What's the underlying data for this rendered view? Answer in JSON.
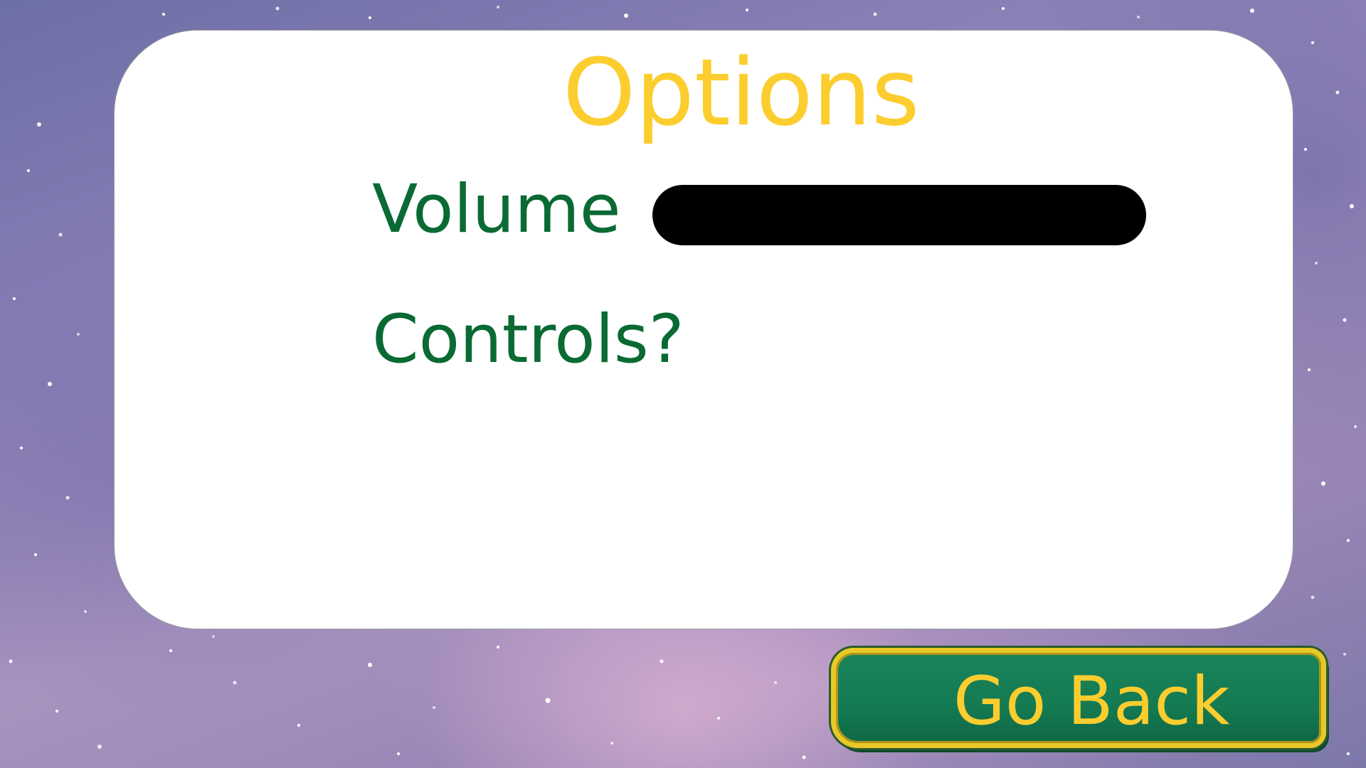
{
  "options_menu": {
    "title": "Options",
    "volume_label": "Volume",
    "volume_level": 1.0,
    "controls_label": "Controls?",
    "go_back_label": "Go Back"
  },
  "colors": {
    "title": "#fccd2e",
    "labels": "#0a6a33",
    "button_fill": "#147a52",
    "button_border": "#e8c928",
    "slider": "#000000"
  }
}
